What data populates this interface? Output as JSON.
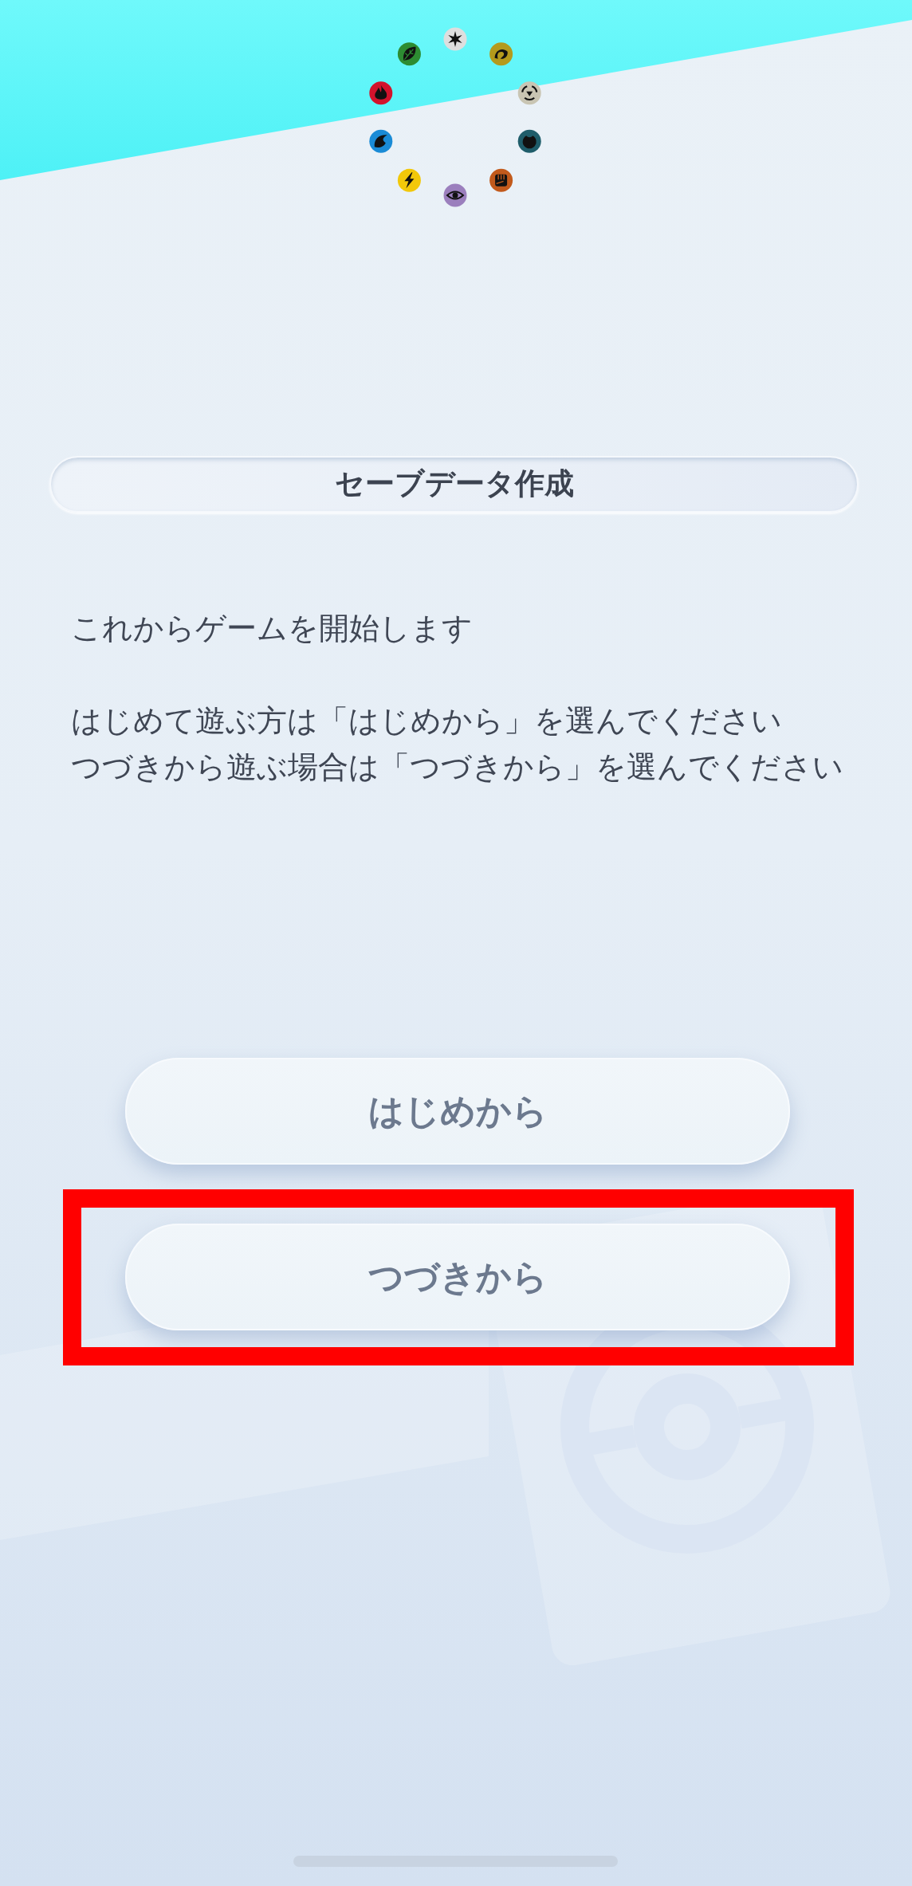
{
  "title": "セーブデータ作成",
  "message": {
    "intro": "これからゲームを開始します",
    "instructions": [
      "はじめて遊ぶ方は「はじめから」を選んでください",
      "つづきから遊ぶ場合は「つづきから」を選んでください"
    ]
  },
  "buttons": [
    {
      "label": "はじめから",
      "highlighted": false
    },
    {
      "label": "つづきから",
      "highlighted": true
    }
  ]
}
